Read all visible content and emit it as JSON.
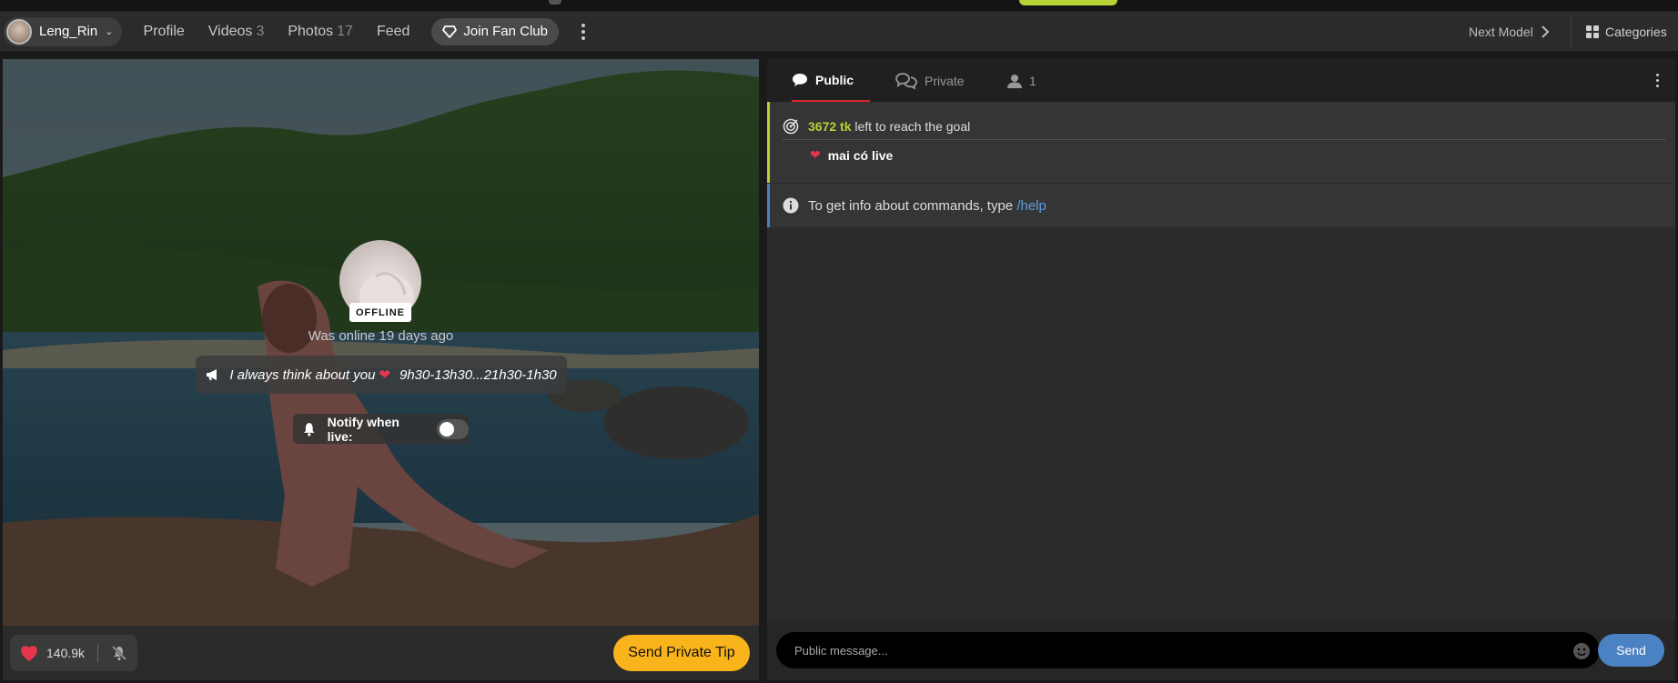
{
  "navbar": {
    "username": "Leng_Rin",
    "links": [
      {
        "label": "Profile",
        "count": ""
      },
      {
        "label": "Videos",
        "count": "3"
      },
      {
        "label": "Photos",
        "count": "17"
      },
      {
        "label": "Feed",
        "count": ""
      }
    ],
    "fan_club_label": "Join Fan Club",
    "next_model_label": "Next Model",
    "categories_label": "Categories"
  },
  "video": {
    "status_badge": "OFFLINE",
    "last_online": "Was online 19 days ago",
    "topic_text": "I always think about you",
    "topic_schedule": "9h30-13h30...21h30-1h30",
    "notify_label": "Notify when live:",
    "notify_enabled": false,
    "likes": "140.9k",
    "tip_button_label": "Send Private Tip"
  },
  "chat": {
    "tabs": [
      {
        "label": "Public",
        "active": true
      },
      {
        "label": "Private",
        "active": false
      },
      {
        "label": "1",
        "active": false
      }
    ],
    "goal": {
      "tokens": "3672 tk",
      "text": "left to reach the goal",
      "title": "mai có live"
    },
    "info": {
      "text": "To get info about commands, type",
      "command": "/help"
    },
    "input_placeholder": "Public message...",
    "send_label": "Send"
  },
  "colors": {
    "accent_green": "#b5d334",
    "tip_yellow": "#f8b41a",
    "send_blue": "#4b82c4",
    "active_tab_red": "#d9262c",
    "heart_red": "#e8354e"
  },
  "icons": [
    "chevron-down-icon",
    "diamond-icon",
    "kebab-icon",
    "chevron-right-icon",
    "grid-icon",
    "megaphone-icon",
    "bell-icon",
    "heart-icon",
    "bell-off-icon",
    "chat-bubble-icon",
    "private-chat-icon",
    "user-icon",
    "goal-icon",
    "info-icon",
    "smiley-icon"
  ]
}
